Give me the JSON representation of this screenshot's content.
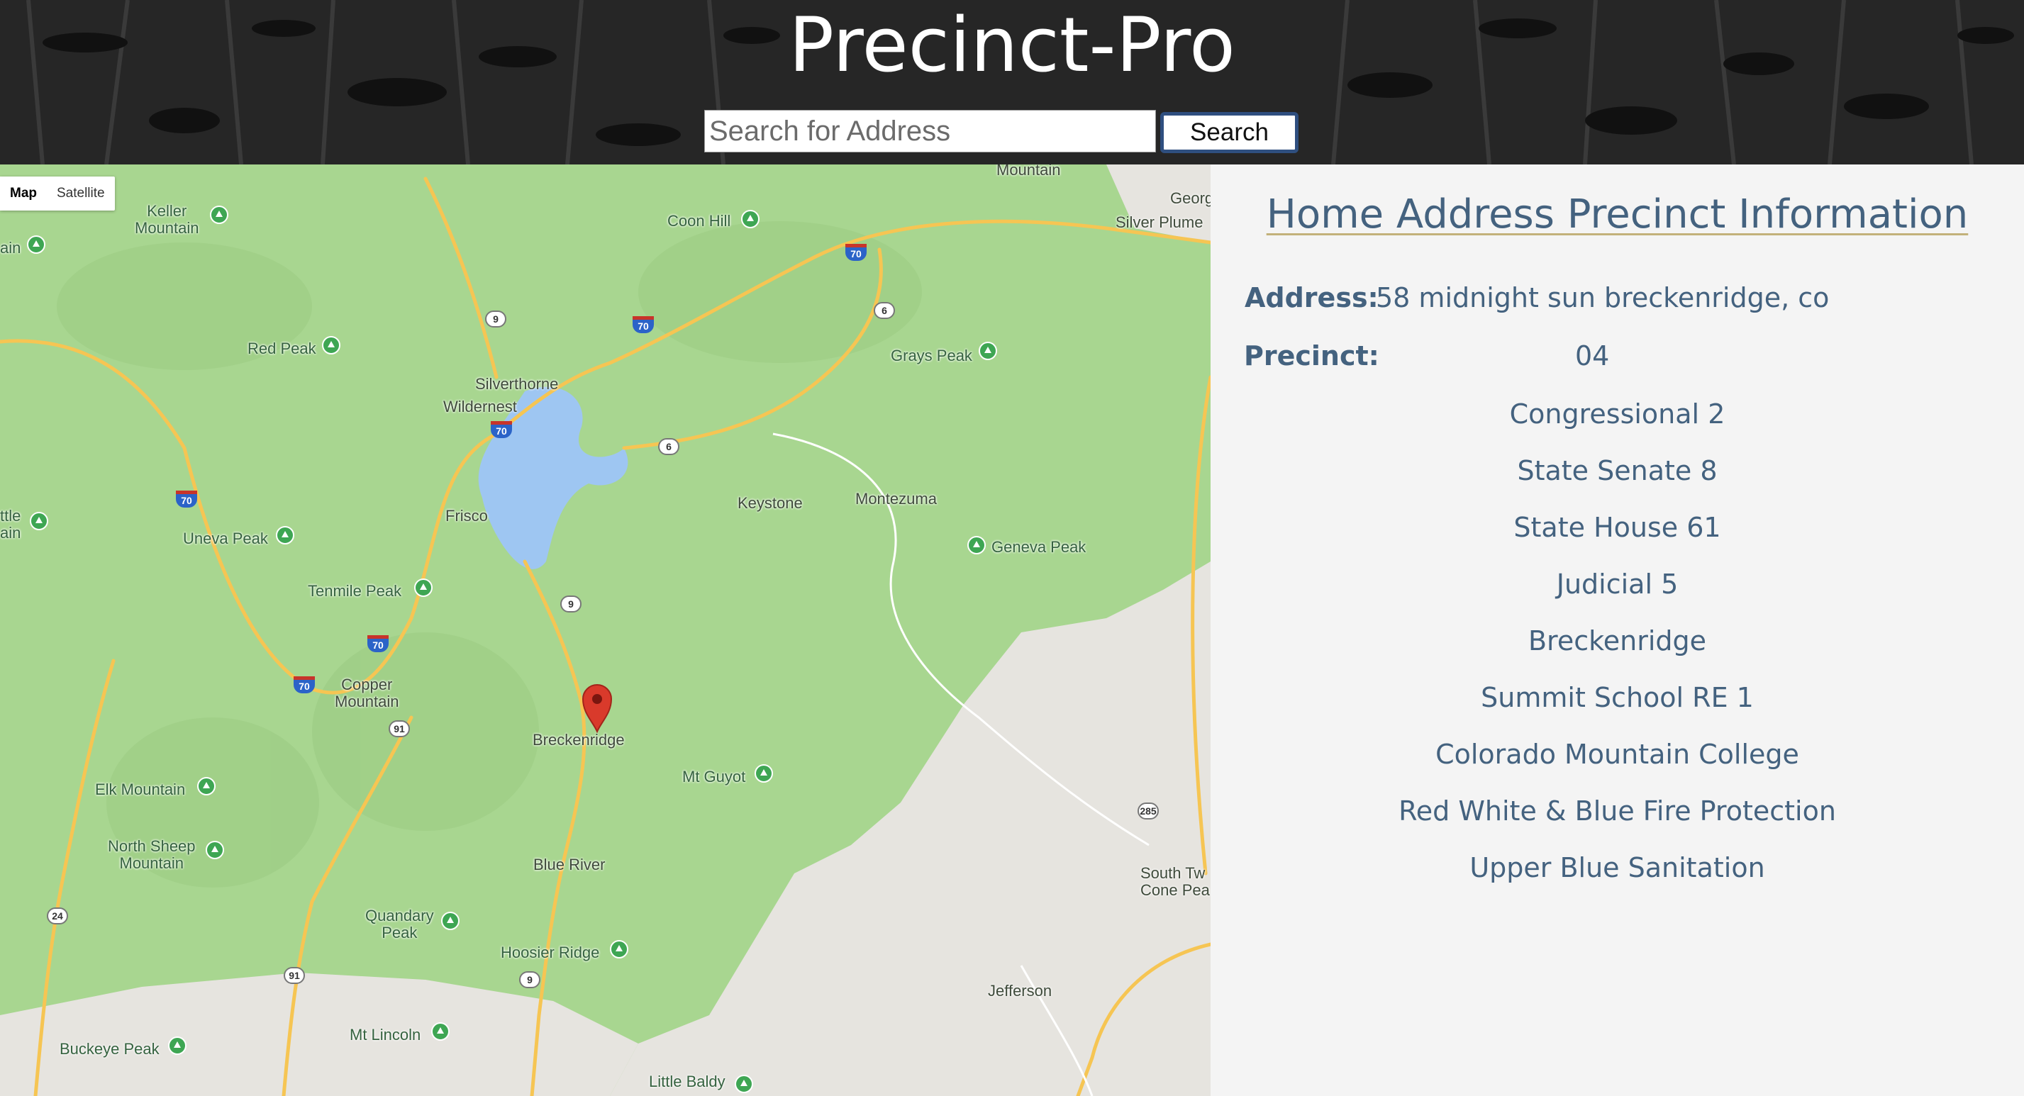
{
  "header": {
    "title": "Precinct-Pro",
    "search_placeholder": "Search for Address",
    "search_value": "",
    "search_button": "Search"
  },
  "map": {
    "type_controls": {
      "map": "Map",
      "satellite": "Satellite"
    },
    "marker": "map-pin-icon",
    "colors": {
      "forest": "#a8d690",
      "terrain": "#e6e4df",
      "water": "#9ec6f2",
      "roads": "#f6c553"
    },
    "labels": {
      "mountain_top": "Mountain",
      "georg": "Georg",
      "silver_plume": "Silver Plume",
      "keller": "Keller\nMountain",
      "ain": "ain",
      "coon_hill": "Coon Hill",
      "red_peak": "Red Peak",
      "silverthorne": "Silverthorne",
      "wildernest": "Wildernest",
      "grays_peak": "Grays Peak",
      "keystone": "Keystone",
      "montezuma": "Montezuma",
      "little_ain": "ttle\nain",
      "uneva_peak": "Uneva Peak",
      "frisco": "Frisco",
      "geneva_peak": "Geneva Peak",
      "tenmile_peak": "Tenmile Peak",
      "copper_mountain": "Copper\nMountain",
      "breckenridge": "Breckenridge",
      "mt_guyot": "Mt Guyot",
      "elk_mountain": "Elk Mountain",
      "north_sheep": "North Sheep\nMountain",
      "blue_river": "Blue River",
      "south_tw": "South Tw\nCone Pea",
      "quandary": "Quandary\nPeak",
      "hoosier_ridge": "Hoosier Ridge",
      "jefferson": "Jefferson",
      "buckeye_peak": "Buckeye Peak",
      "mt_lincoln": "Mt Lincoln",
      "little_baldy": "Little Baldy"
    },
    "shields": {
      "i70": "70",
      "us6": "6",
      "sh9": "9",
      "sh91": "91",
      "us285": "285",
      "us24": "24"
    }
  },
  "info": {
    "title": "Home Address Precinct Information",
    "address_label": "Address:",
    "address_value": "58 midnight sun breckenridge, co",
    "precinct_label": "Precinct:",
    "precinct_value": "04",
    "districts": [
      "Congressional 2",
      "State Senate 8",
      "State House 61",
      "Judicial 5",
      "Breckenridge",
      "Summit School RE 1",
      "Colorado Mountain College",
      "Red White & Blue Fire Protection",
      "Upper Blue Sanitation"
    ]
  }
}
